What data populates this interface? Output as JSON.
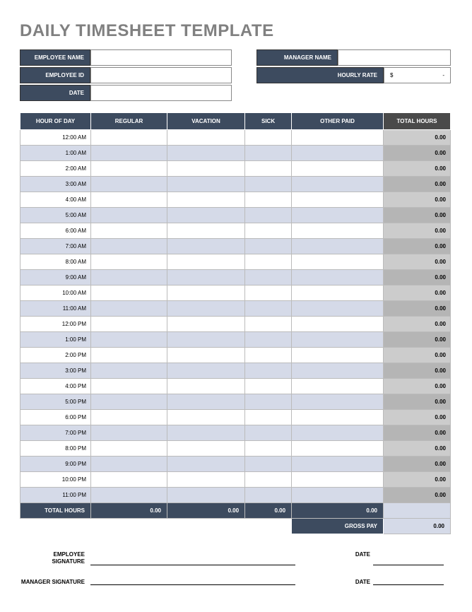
{
  "title": "DAILY TIMESHEET TEMPLATE",
  "info": {
    "emp_name_label": "EMPLOYEE NAME",
    "emp_name_value": "",
    "mgr_name_label": "MANAGER NAME",
    "mgr_name_value": "",
    "emp_id_label": "EMPLOYEE ID",
    "emp_id_value": "",
    "rate_label": "HOURLY RATE",
    "rate_currency": "$",
    "rate_dash": "-",
    "date_label": "DATE",
    "date_value": ""
  },
  "columns": {
    "hour": "HOUR OF DAY",
    "regular": "REGULAR",
    "vacation": "VACATION",
    "sick": "SICK",
    "other": "OTHER PAID",
    "total": "TOTAL HOURS"
  },
  "rows": [
    {
      "hour": "12:00 AM",
      "regular": "",
      "vacation": "",
      "sick": "",
      "other": "",
      "total": "0.00",
      "alt": false
    },
    {
      "hour": "1:00 AM",
      "regular": "",
      "vacation": "",
      "sick": "",
      "other": "",
      "total": "0.00",
      "alt": true
    },
    {
      "hour": "2:00 AM",
      "regular": "",
      "vacation": "",
      "sick": "",
      "other": "",
      "total": "0.00",
      "alt": false
    },
    {
      "hour": "3:00 AM",
      "regular": "",
      "vacation": "",
      "sick": "",
      "other": "",
      "total": "0.00",
      "alt": true
    },
    {
      "hour": "4:00 AM",
      "regular": "",
      "vacation": "",
      "sick": "",
      "other": "",
      "total": "0.00",
      "alt": false
    },
    {
      "hour": "5:00 AM",
      "regular": "",
      "vacation": "",
      "sick": "",
      "other": "",
      "total": "0.00",
      "alt": true
    },
    {
      "hour": "6:00 AM",
      "regular": "",
      "vacation": "",
      "sick": "",
      "other": "",
      "total": "0.00",
      "alt": false
    },
    {
      "hour": "7:00 AM",
      "regular": "",
      "vacation": "",
      "sick": "",
      "other": "",
      "total": "0.00",
      "alt": true
    },
    {
      "hour": "8:00 AM",
      "regular": "",
      "vacation": "",
      "sick": "",
      "other": "",
      "total": "0.00",
      "alt": false
    },
    {
      "hour": "9:00 AM",
      "regular": "",
      "vacation": "",
      "sick": "",
      "other": "",
      "total": "0.00",
      "alt": true
    },
    {
      "hour": "10:00 AM",
      "regular": "",
      "vacation": "",
      "sick": "",
      "other": "",
      "total": "0.00",
      "alt": false
    },
    {
      "hour": "11:00 AM",
      "regular": "",
      "vacation": "",
      "sick": "",
      "other": "",
      "total": "0.00",
      "alt": true
    },
    {
      "hour": "12:00 PM",
      "regular": "",
      "vacation": "",
      "sick": "",
      "other": "",
      "total": "0.00",
      "alt": false
    },
    {
      "hour": "1:00 PM",
      "regular": "",
      "vacation": "",
      "sick": "",
      "other": "",
      "total": "0.00",
      "alt": true
    },
    {
      "hour": "2:00 PM",
      "regular": "",
      "vacation": "",
      "sick": "",
      "other": "",
      "total": "0.00",
      "alt": false
    },
    {
      "hour": "3:00 PM",
      "regular": "",
      "vacation": "",
      "sick": "",
      "other": "",
      "total": "0.00",
      "alt": true
    },
    {
      "hour": "4:00 PM",
      "regular": "",
      "vacation": "",
      "sick": "",
      "other": "",
      "total": "0.00",
      "alt": false
    },
    {
      "hour": "5:00 PM",
      "regular": "",
      "vacation": "",
      "sick": "",
      "other": "",
      "total": "0.00",
      "alt": true
    },
    {
      "hour": "6:00 PM",
      "regular": "",
      "vacation": "",
      "sick": "",
      "other": "",
      "total": "0.00",
      "alt": false
    },
    {
      "hour": "7:00 PM",
      "regular": "",
      "vacation": "",
      "sick": "",
      "other": "",
      "total": "0.00",
      "alt": true
    },
    {
      "hour": "8:00 PM",
      "regular": "",
      "vacation": "",
      "sick": "",
      "other": "",
      "total": "0.00",
      "alt": false
    },
    {
      "hour": "9:00 PM",
      "regular": "",
      "vacation": "",
      "sick": "",
      "other": "",
      "total": "0.00",
      "alt": true
    },
    {
      "hour": "10:00 PM",
      "regular": "",
      "vacation": "",
      "sick": "",
      "other": "",
      "total": "0.00",
      "alt": false
    },
    {
      "hour": "11:00 PM",
      "regular": "",
      "vacation": "",
      "sick": "",
      "other": "",
      "total": "0.00",
      "alt": true
    }
  ],
  "totals": {
    "label": "TOTAL HOURS",
    "regular": "0.00",
    "vacation": "0.00",
    "sick": "0.00",
    "other": "0.00",
    "total": ""
  },
  "grosspay": {
    "label": "GROSS PAY",
    "value": "0.00"
  },
  "signatures": {
    "emp_label": "EMPLOYEE SIGNATURE",
    "mgr_label": "MANAGER SIGNATURE",
    "date_label": "DATE"
  }
}
